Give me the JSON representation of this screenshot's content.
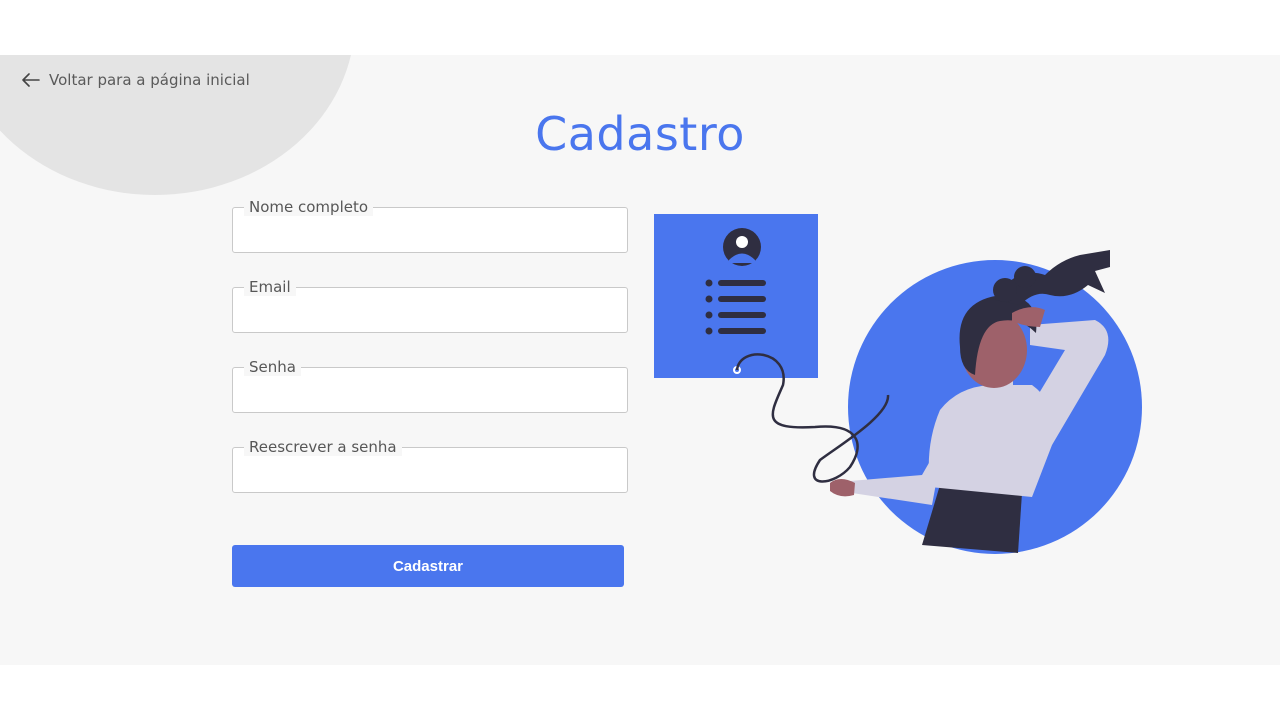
{
  "nav": {
    "back_label": "Voltar para a página inicial",
    "back_icon": "arrow-left-icon"
  },
  "page": {
    "title": "Cadastro"
  },
  "form": {
    "fields": [
      {
        "label": "Nome completo",
        "value": "",
        "type": "text"
      },
      {
        "label": "Email",
        "value": "",
        "type": "email"
      },
      {
        "label": "Senha",
        "value": "",
        "type": "password"
      },
      {
        "label": "Reescrever a senha",
        "value": "",
        "type": "password"
      }
    ],
    "submit_label": "Cadastrar"
  },
  "colors": {
    "accent": "#4a76ee",
    "background": "#f7f7f7",
    "decor_circle": "#e4e4e4"
  }
}
